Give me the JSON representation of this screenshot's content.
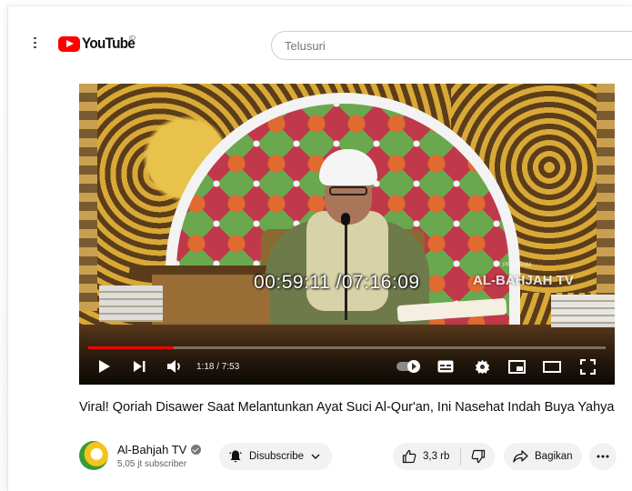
{
  "header": {
    "logo_text": "YouTube",
    "logo_country": "ID",
    "search_placeholder": "Telusuri"
  },
  "video": {
    "overlay_timestamp": "00:59:11 /07:16:09",
    "watermark": "AL-BAHJAH TV",
    "watermark_sub": "PROGRAM",
    "current_time": "1:18 / 7:53",
    "progress_fraction": 0.165
  },
  "meta": {
    "title": "Viral! Qoriah Disawer Saat Melantunkan Ayat Suci Al-Qur'an, Ini Nasehat Indah Buya Yahya",
    "channel_name": "Al-Bahjah TV",
    "subscriber_count": "5,05 jt subscriber",
    "subscribe_label": "Disubscribe",
    "like_count": "3,3 rb",
    "share_label": "Bagikan"
  },
  "icons": {
    "menu": "menu-icon",
    "play": "play-icon",
    "next": "next-icon",
    "volume": "volume-icon",
    "autoplay": "autoplay-toggle",
    "subtitles": "subtitles-icon",
    "settings": "gear-icon",
    "miniplayer": "miniplayer-icon",
    "theater": "theater-icon",
    "fullscreen": "fullscreen-icon",
    "bell": "bell-icon",
    "like": "thumbs-up-icon",
    "dislike": "thumbs-down-icon",
    "share": "share-icon",
    "more": "more-icon"
  },
  "colors": {
    "brand_red": "#ff0000",
    "pill_bg": "#f2f2f2",
    "text": "#0f0f0f"
  }
}
